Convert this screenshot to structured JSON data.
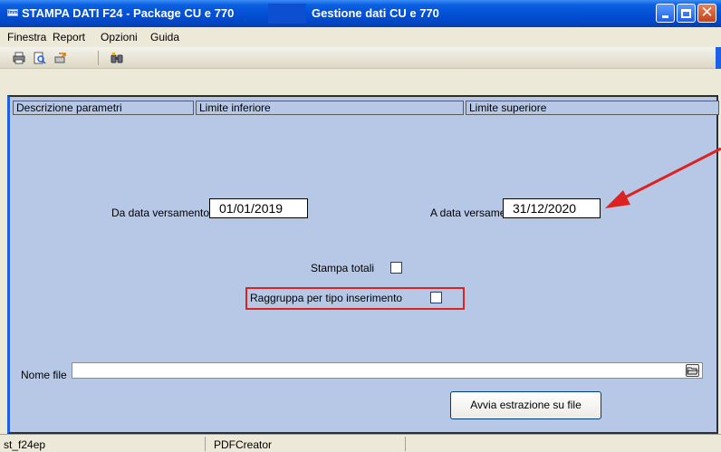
{
  "window": {
    "title_left": "STAMPA DATI F24 - Package CU e 770",
    "title_right": "Gestione dati CU e 770",
    "app_icon_text": "tmm"
  },
  "menu": {
    "items": [
      "Finestra",
      "Report",
      "Opzioni",
      "Guida"
    ]
  },
  "toolbar": {
    "icons": [
      "print-icon",
      "print-preview-icon",
      "export-icon",
      "binoculars-icon"
    ]
  },
  "grid_header": {
    "col1": "Descrizione parametri",
    "col2": "Limite inferiore",
    "col3": "Limite superiore"
  },
  "form": {
    "from_label": "Da data versamento",
    "from_value": "01/01/2019",
    "to_label": "A data versament",
    "to_value": "31/12/2020",
    "print_totals_label": "Stampa totali",
    "group_label": "Raggruppa per tipo inserimento",
    "file_label": "Nome file",
    "file_value": "",
    "action_label": "Avvia estrazione su file"
  },
  "status": {
    "left": "st_f24ep",
    "middle": "PDFCreator"
  },
  "colors": {
    "accent_blue": "#0451d6",
    "workspace": "#b6c8e6",
    "highlight_red": "#dd2222"
  }
}
